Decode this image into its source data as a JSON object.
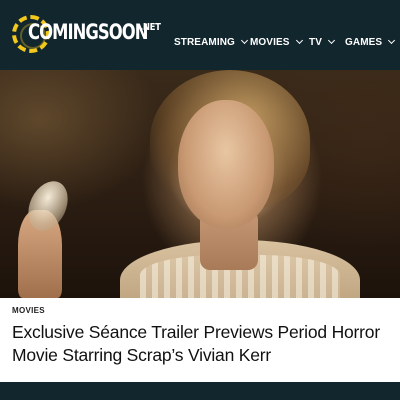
{
  "header": {
    "logo": {
      "name": "COMINGSOON",
      "tld": ".NET"
    },
    "nav": [
      {
        "label": "STREAMING"
      },
      {
        "label": "MOVIES"
      },
      {
        "label": "TV"
      },
      {
        "label": "GAMES"
      }
    ]
  },
  "article": {
    "category": "MOVIES",
    "title": "Exclusive Séance Trailer Previews Period Horror Movie Starring Scrap’s Vivian Kerr"
  },
  "colors": {
    "header_bg": "#12262e",
    "logo_accent": "#f2c81b"
  },
  "icons": [
    "chevron-down-icon"
  ]
}
